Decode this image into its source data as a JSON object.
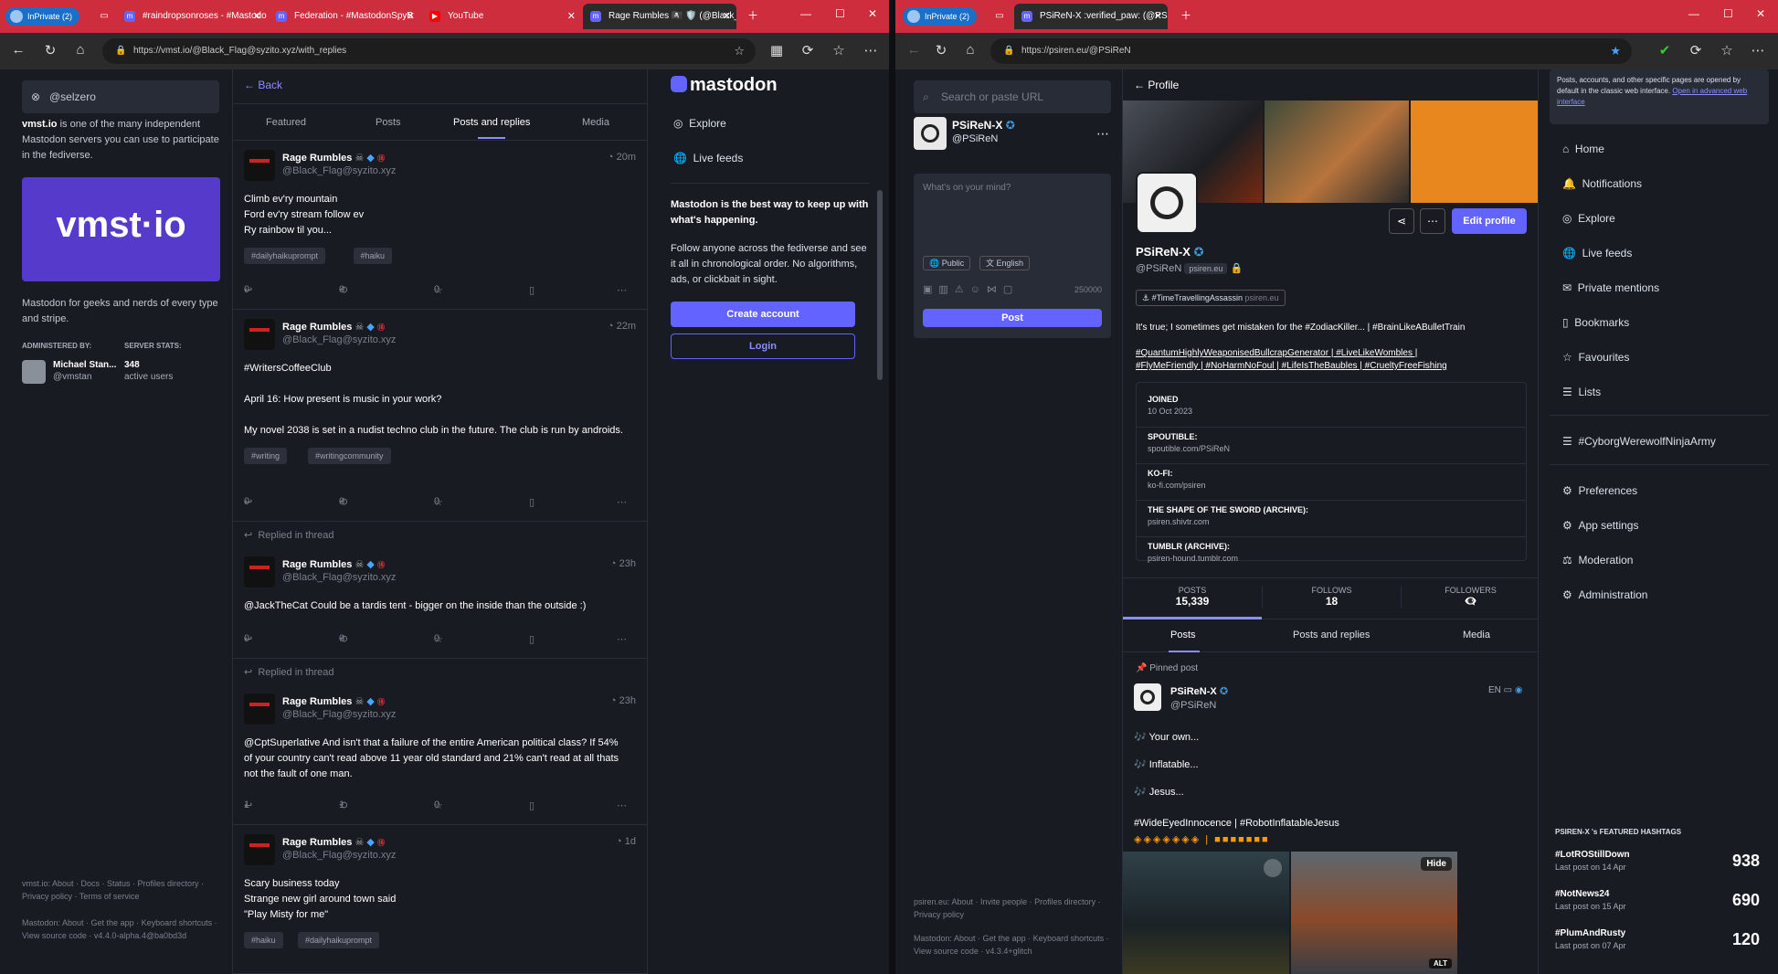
{
  "left": {
    "tabs": [
      "InPrivate (2)",
      "#raindropsonroses - #Mastodo",
      "Federation - #MastodonSpyB",
      "YouTube",
      "Rage Rumbles 🏴‍☠️ 🛡️ (@Black_"
    ],
    "url": "https://vmst.io/@Black_Flag@syzito.xyz/with_replies",
    "search_value": "@selzero",
    "about_html": "is one of the many independent Mastodon servers you can use to participate in the fediverse.",
    "server_name": "vmst.io",
    "logo_text": "vmst·io",
    "tagline": "Mastodon for geeks and nerds of every type and stripe.",
    "administered_by": "ADMINISTERED BY:",
    "server_stats": "SERVER STATS:",
    "admin_name": "Michael Stan...",
    "admin_handle": "@vmstan",
    "stats_count": "348",
    "stats_label": "active users",
    "footer1": "vmst.io: About · Docs · Status · Profiles directory · Privacy policy · Terms of service",
    "footer2": "Mastodon: About · Get the app · Keyboard shortcuts · View source code · v4.4.0-alpha.4@ba0bd3d",
    "back": "Back",
    "profile_tabs": [
      "Featured",
      "Posts",
      "Posts and replies",
      "Media"
    ],
    "posts": [
      {
        "name": "Rage Rumbles",
        "handle": "@Black_Flag@syzito.xyz",
        "time": "20m",
        "lines": [
          "Climb ev'ry mountain",
          "Ford ev'ry stream follow ev",
          "Ry rainbow til you..."
        ],
        "tags": [
          "#dailyhaikuprompt",
          "#haiku"
        ],
        "reply": "0",
        "boost": "0",
        "fav": "0"
      },
      {
        "name": "Rage Rumbles",
        "handle": "@Black_Flag@syzito.xyz",
        "time": "22m",
        "lines": [
          "#WritersCoffeeClub",
          "",
          "April 16: How present is music in your work?",
          "",
          "My novel 2038 is set in a nudist techno club in the future. The club is run by androids."
        ],
        "tags": [
          "#writing",
          "#writingcommunity"
        ],
        "reply": "0",
        "boost": "0",
        "fav": "0"
      },
      {
        "replied": "Replied in thread",
        "name": "Rage Rumbles",
        "handle": "@Black_Flag@syzito.xyz",
        "time": "23h",
        "lines": [
          "@JackTheCat Could be a tardis tent - bigger on the inside than the outside :)"
        ],
        "tags": [],
        "reply": "0",
        "boost": "0",
        "fav": "0"
      },
      {
        "replied": "Replied in thread",
        "name": "Rage Rumbles",
        "handle": "@Black_Flag@syzito.xyz",
        "time": "23h",
        "lines": [
          "@CptSuperlative And isn't that a failure of the entire American political class? If 54%",
          "of your country can't read above 11 year old standard and 21% can't read at all thats",
          "not the fault of one man."
        ],
        "tags": [],
        "reply": "1",
        "boost": "1",
        "fav": "0"
      },
      {
        "name": "Rage Rumbles",
        "handle": "@Black_Flag@syzito.xyz",
        "time": "1d",
        "lines": [
          "Scary business today",
          "Strange new girl around town said",
          "\"Play Misty for me\""
        ],
        "tags": [
          "#haiku",
          "#dailyhaikuprompt"
        ],
        "reply": "0",
        "boost": "0",
        "fav": "0"
      }
    ],
    "brand": "mastodon",
    "nav": [
      "Explore",
      "Live feeds"
    ],
    "promo_bold": "Mastodon is the best way to keep up with what's happening.",
    "promo_text": "Follow anyone across the fediverse and see it all in chronological order. No algorithms, ads, or clickbait in sight.",
    "create_account": "Create account",
    "login": "Login"
  },
  "right": {
    "tabs": [
      "InPrivate (2)",
      "PSiReN-X :verified_paw: (@PSiRe"
    ],
    "url": "https://psiren.eu/@PSiReN",
    "search_placeholder": "Search or paste URL",
    "me_name": "PSiReN-X",
    "me_handle": "@PSiReN",
    "compose_placeholder": "What's on your mind?",
    "visibility": "Public",
    "language": "English",
    "char_count": "250000",
    "post_btn": "Post",
    "footer1": "psiren.eu: About · Invite people · Profiles directory · Privacy policy",
    "footer2": "Mastodon: About · Get the app · Keyboard shortcuts · View source code · v4.3.4+glitch",
    "profile_title": "Profile",
    "edit_profile": "Edit profile",
    "display_name": "PSiReN-X",
    "acct": "@PSiReN",
    "domain_badge": "psiren.eu",
    "featured_tag": "#TimeTravellingAssassin",
    "featured_tag_domain": "psiren.eu",
    "bio1": "It's true; I sometimes get mistaken for the #ZodiacKiller... | #BrainLikeABulletTrain",
    "bio2": "#QuantumHighlyWeaponisedBullcrapGenerator | #LiveLikeWombles |",
    "bio3": "#FlyMeFriendly | #NoHarmNoFoul | #LifeIsTheBaubles | #CrueltyFreeFishing",
    "fields": [
      {
        "k": "JOINED",
        "v": "10 Oct 2023"
      },
      {
        "k": "SPOUTIBLE:",
        "v": "spoutible.com/PSiReN"
      },
      {
        "k": "KO-FI:",
        "v": "ko-fi.com/psiren"
      },
      {
        "k": "THE SHAPE OF THE SWORD (ARCHIVE):",
        "v": "psiren.shivtr.com"
      },
      {
        "k": "TUMBLR (ARCHIVE):",
        "v": "psiren-hound.tumblr.com"
      }
    ],
    "stats": [
      {
        "label": "POSTS",
        "value": "15,339"
      },
      {
        "label": "FOLLOWS",
        "value": "18"
      },
      {
        "label": "FOLLOWERS",
        "value": "👁‍🗨"
      }
    ],
    "post_tabs": [
      "Posts",
      "Posts and replies",
      "Media"
    ],
    "pinned": "Pinned post",
    "pinned_lang": "EN",
    "pinned_lines": [
      "🎶 Your own...",
      "🎶 Inflatable...",
      "🎶 Jesus..."
    ],
    "pinned_tags": "#WideEyedInnocence | #RobotInflatableJesus",
    "hide": "Hide",
    "alt": "ALT",
    "notice": "Posts, accounts, and other specific pages are opened by default in the classic web interface.",
    "notice_link": "Open in advanced web interface",
    "nav": [
      "Home",
      "Notifications",
      "Explore",
      "Live feeds",
      "Private mentions",
      "Bookmarks",
      "Favourites",
      "Lists",
      "#CyborgWerewolfNinjaArmy",
      "Preferences",
      "App settings",
      "Moderation",
      "Administration"
    ],
    "featured_title": "PSIREN-X 's FEATURED HASHTAGS",
    "featured": [
      {
        "tag": "#LotROStillDown",
        "date": "Last post on 14 Apr",
        "count": "938"
      },
      {
        "tag": "#NotNews24",
        "date": "Last post on 15 Apr",
        "count": "690"
      },
      {
        "tag": "#PlumAndRusty",
        "date": "Last post on 07 Apr",
        "count": "120"
      }
    ]
  },
  "colors": {
    "accent": "#6364ff",
    "bg": "#191b22",
    "tabbar": "#ce2d3d",
    "verified": "#3f9bdf"
  }
}
